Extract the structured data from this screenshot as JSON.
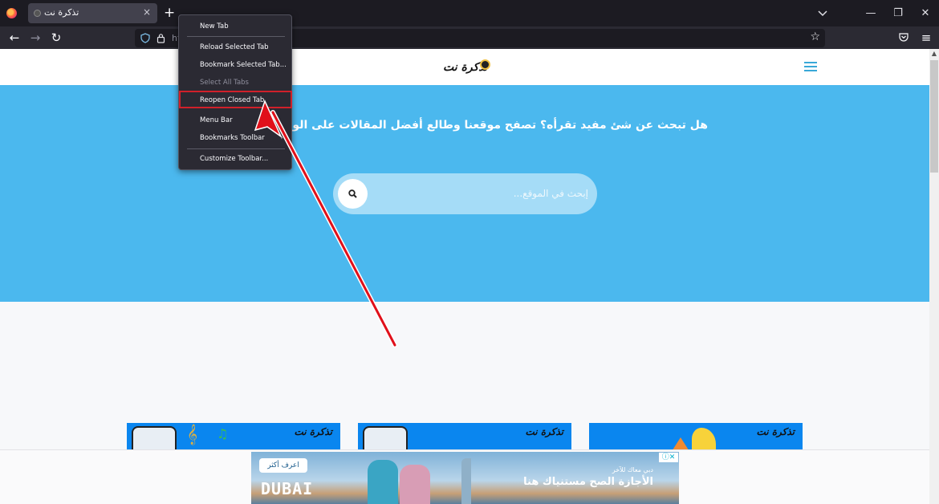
{
  "browser": {
    "tab": {
      "title": "تذكرة نت",
      "close_glyph": "×"
    },
    "new_tab_glyph": "+",
    "tablist_glyph": "⌄",
    "window_controls": {
      "minimize": "—",
      "restore": "❐",
      "close": "✕"
    },
    "nav": {
      "back": "←",
      "forward": "→",
      "reload": "↻"
    },
    "url_partial": "ht",
    "bookmark_star": "☆",
    "menu_glyph": "≡"
  },
  "context_menu": {
    "items": [
      {
        "label": "New Tab",
        "state": "enabled"
      },
      {
        "label": "Reload Selected Tab",
        "state": "enabled"
      },
      {
        "label": "Bookmark Selected Tab...",
        "state": "enabled"
      },
      {
        "label": "Select All Tabs",
        "state": "disabled"
      },
      {
        "label": "Reopen Closed Tab",
        "state": "highlighted"
      },
      {
        "label": "Menu Bar",
        "state": "enabled"
      },
      {
        "label": "Bookmarks Toolbar",
        "state": "enabled",
        "submenu_arrow": "›"
      },
      {
        "label": "Customize Toolbar...",
        "state": "enabled"
      }
    ]
  },
  "site": {
    "logo_text": "تذكرة نت",
    "hero_text": "هل تبحث عن شئ مفيد تقرأه؟ تصفح موقعنا وطالع أفضل المقالات على الويب في مجال",
    "search": {
      "placeholder": "إبحث في الموقع...",
      "value": ""
    },
    "cards": [
      {
        "logo": "تذكرة نت"
      },
      {
        "logo": "تذكرة نت"
      },
      {
        "logo": "تذكرة نت"
      }
    ],
    "collapse_glyph": "⌄"
  },
  "ad": {
    "cta": "اعرف أكثر",
    "brand": "DUBAI",
    "small_text": "دبي معاك للآخر",
    "headline": "الأجازة الصح مستنياك هنا",
    "adchoices": "ⓘ✕"
  },
  "scrollbar": {
    "up_glyph": "▲"
  },
  "colors": {
    "hero_bg": "#4bb8ee",
    "menu_bg": "#2b2a33",
    "highlight": "#d0202a",
    "annotation_arrow": "#e0101a"
  }
}
